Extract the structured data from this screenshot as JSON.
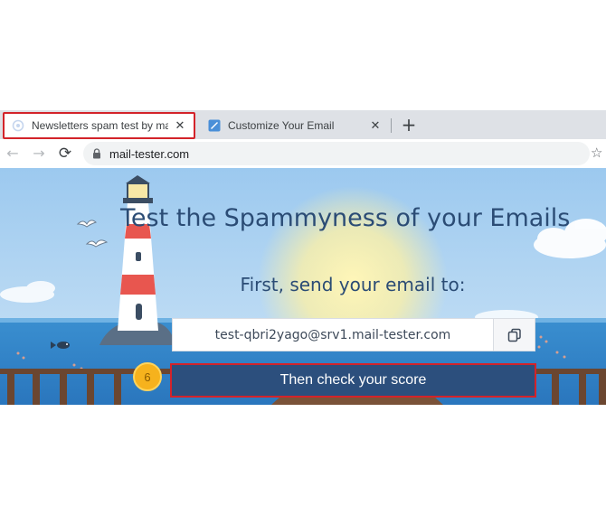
{
  "browser": {
    "tabs": [
      {
        "title": "Newsletters spam test by mail-te",
        "active": true,
        "favicon": "loading-icon"
      },
      {
        "title": "Customize Your Email",
        "active": false,
        "favicon": "email-editor-icon"
      }
    ],
    "close_glyph": "✕",
    "new_tab_glyph": "+",
    "url": "mail-tester.com"
  },
  "page": {
    "headline": "Test the Spammyness of your Emails",
    "instruction": "First, send your email to:",
    "email_address": "test-qbri2yago@srv1.mail-tester.com",
    "check_button": "Then check your score",
    "badge": "6"
  },
  "colors": {
    "highlight": "#d3232a",
    "brand_blue": "#2c4f7d",
    "heading": "#2b4c75",
    "badge": "#f6b21d"
  }
}
